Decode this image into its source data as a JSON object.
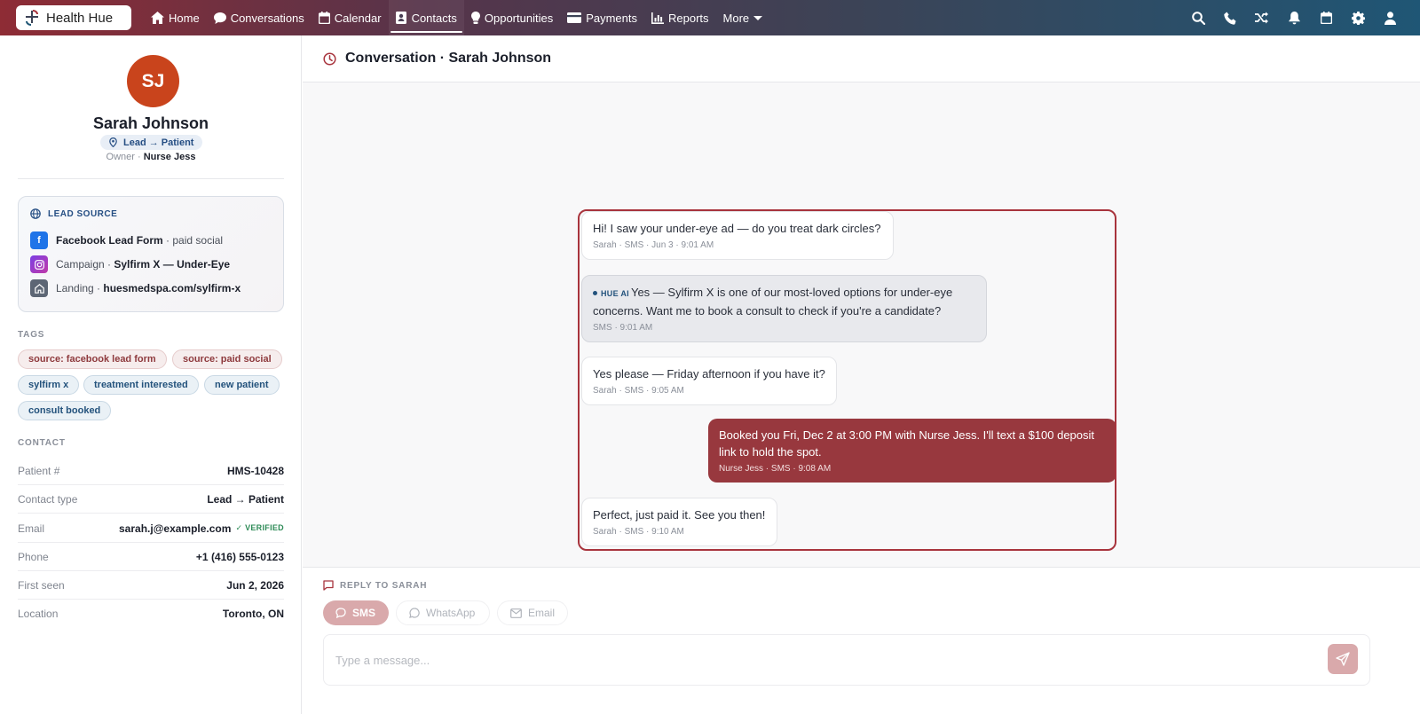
{
  "brand": {
    "name": "Health Hue"
  },
  "nav": {
    "items": [
      {
        "label": "Home",
        "icon": "home-icon"
      },
      {
        "label": "Conversations",
        "icon": "chat-icon"
      },
      {
        "label": "Calendar",
        "icon": "calendar-icon"
      },
      {
        "label": "Contacts",
        "icon": "contacts-icon",
        "active": true
      },
      {
        "label": "Opportunities",
        "icon": "lightbulb-icon"
      },
      {
        "label": "Payments",
        "icon": "card-icon"
      },
      {
        "label": "Reports",
        "icon": "chart-icon"
      },
      {
        "label": "More",
        "icon": "chevron-down-icon"
      }
    ],
    "right_icons": [
      "search-icon",
      "phone-icon",
      "shuffle-icon",
      "bell-icon",
      "calendar-icon",
      "gear-icon",
      "user-icon"
    ]
  },
  "contact": {
    "initials": "SJ",
    "name": "Sarah Johnson",
    "status": "Lead → Patient",
    "owner_label": "Owner ·",
    "owner": "Nurse Jess",
    "avatar_color": "#c9441c"
  },
  "lead_source": {
    "title": "LEAD SOURCE",
    "form_name": "Facebook Lead Form",
    "form_suffix": "· paid social",
    "campaign_label": "Campaign ·",
    "campaign": "Sylfirm X — Under-Eye",
    "landing_label": "Landing ·",
    "landing": "huesmedspa.com/sylfirm-x"
  },
  "tags": {
    "title": "TAGS",
    "items": [
      "source: facebook lead form",
      "source: paid social",
      "sylfirm x",
      "treatment interested",
      "new patient",
      "consult booked"
    ]
  },
  "contact_info": {
    "title": "CONTACT",
    "rows": [
      {
        "k": "Patient #",
        "v": "HMS-10428"
      },
      {
        "k": "Contact type",
        "v": "Lead → Patient"
      },
      {
        "k": "Email",
        "v": "sarah.j@example.com",
        "badge": "✓ VERIFIED"
      },
      {
        "k": "Phone",
        "v": "+1 (416) 555-0123"
      },
      {
        "k": "First seen",
        "v": "Jun 2, 2026"
      },
      {
        "k": "Location",
        "v": "Toronto, ON"
      }
    ]
  },
  "conversation": {
    "title": "Conversation · Sarah Johnson",
    "messages": [
      {
        "text": "Hi! I saw your under-eye ad — do you treat dark circles?",
        "meta": "Sarah · SMS · Jun 3 · 9:01 AM"
      },
      {
        "badge": "HUE AI",
        "text": "Yes — Sylfirm X is one of our most-loved options for under-eye concerns. Want me to book a consult to check if you're a candidate?",
        "meta": "SMS · 9:01 AM"
      },
      {
        "text": "Yes please — Friday afternoon if you have it?",
        "meta": "Sarah · SMS · 9:05 AM"
      },
      {
        "text": "Booked you Fri, Dec 2 at 3:00 PM with Nurse Jess. I'll text a $100 deposit link to hold the spot.",
        "meta": "Nurse Jess · SMS · 9:08 AM"
      },
      {
        "text": "Perfect, just paid it. See you then!",
        "meta": "Sarah · SMS · 9:10 AM"
      }
    ]
  },
  "reply": {
    "label": "REPLY TO SARAH",
    "channels": [
      "SMS",
      "WhatsApp",
      "Email"
    ],
    "placeholder": "Type a message..."
  },
  "colors": {
    "accent": "#98383e",
    "accent_light": "#d9a9ab",
    "link_blue": "#23527c"
  }
}
